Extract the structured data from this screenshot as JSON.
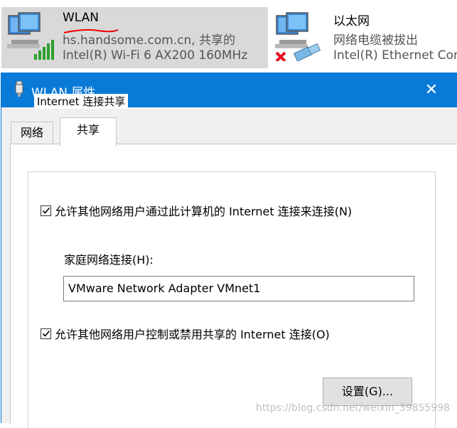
{
  "adapters": [
    {
      "name": "WLAN",
      "status": "hs.handsome.com.cn, 共享的",
      "device": "Intel(R) Wi-Fi 6 AX200 160MHz",
      "icon": "wifi-adapter-icon"
    },
    {
      "name": "以太网",
      "status": "网络电缆被拔出",
      "device": "Intel(R) Ethernet Con",
      "icon": "ethernet-adapter-icon"
    }
  ],
  "dialog": {
    "title": "WLAN 属性",
    "close_glyph": "✕",
    "tabs": [
      {
        "label": "网络",
        "selected": false
      },
      {
        "label": "共享",
        "selected": true
      }
    ],
    "group_title": "Internet 连接共享",
    "allow_share_label": "允许其他网络用户通过此计算机的 Internet 连接来连接(N)",
    "allow_share_checked": true,
    "home_network_label": "家庭网络连接(H):",
    "home_network_value": "VMware Network Adapter VMnet1",
    "allow_control_label": "允许其他网络用户控制或禁用共享的 Internet 连接(O)",
    "allow_control_checked": true,
    "settings_button": "设置(G)..."
  },
  "watermark": "https://blog.csdn.net/weixin_39855998",
  "colors": {
    "titlebar": "#0a7ad8",
    "selected_adapter_bg": "#d9d9d9",
    "dialog_bg": "#f0f0f0",
    "status_red": "#e81123",
    "signal_green": "#2ca02c"
  }
}
